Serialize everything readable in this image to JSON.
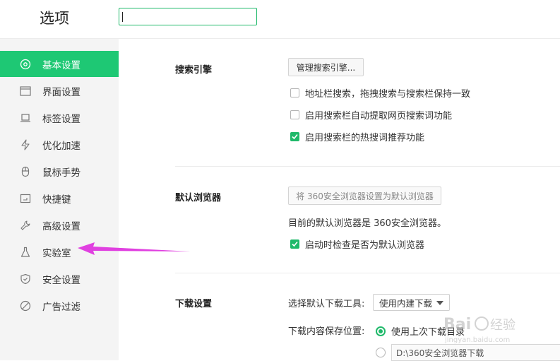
{
  "window": {
    "title": "选项",
    "search_value": ""
  },
  "sidebar": {
    "items": [
      {
        "label": "基本设置",
        "icon": "compass-icon",
        "active": true
      },
      {
        "label": "界面设置",
        "icon": "window-icon",
        "active": false
      },
      {
        "label": "标签设置",
        "icon": "laptop-icon",
        "active": false
      },
      {
        "label": "优化加速",
        "icon": "lightning-icon",
        "active": false
      },
      {
        "label": "鼠标手势",
        "icon": "mouse-icon",
        "active": false
      },
      {
        "label": "快捷键",
        "icon": "keyboard-icon",
        "active": false
      },
      {
        "label": "高级设置",
        "icon": "wrench-icon",
        "active": false
      },
      {
        "label": "实验室",
        "icon": "flask-icon",
        "active": false
      },
      {
        "label": "安全设置",
        "icon": "shield-icon",
        "active": false
      },
      {
        "label": "广告过滤",
        "icon": "block-icon",
        "active": false
      }
    ]
  },
  "search_engine": {
    "title": "搜索引擎",
    "manage_button": "管理搜索引擎...",
    "options": [
      {
        "label": "地址栏搜索，拖拽搜索与搜索栏保持一致",
        "checked": false
      },
      {
        "label": "启用搜索栏自动提取网页搜索词功能",
        "checked": false
      },
      {
        "label": "启用搜索栏的热搜词推荐功能",
        "checked": true
      }
    ]
  },
  "default_browser": {
    "title": "默认浏览器",
    "set_button": "将 360安全浏览器设置为默认浏览器",
    "status": "目前的默认浏览器是 360安全浏览器。",
    "check_on_start": {
      "label": "启动时检查是否为默认浏览器",
      "checked": true
    }
  },
  "download": {
    "title": "下载设置",
    "tool_label": "选择默认下载工具:",
    "tool_value": "使用内建下载",
    "location_label": "下载内容保存位置:",
    "location_options": [
      {
        "label": "使用上次下载目录",
        "checked": true
      },
      {
        "label": "D:\\360安全浏览器下载",
        "checked": false
      }
    ]
  },
  "colors": {
    "accent": "#1ec874",
    "annotation_arrow": "#e040e0"
  }
}
